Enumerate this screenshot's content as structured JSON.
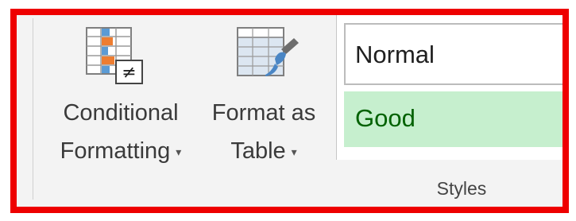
{
  "ribbon": {
    "conditional_formatting": {
      "line1": "Conditional",
      "line2": "Formatting",
      "caret": "▾"
    },
    "format_as_table": {
      "line1": "Format as",
      "line2": "Table",
      "caret": "▾"
    },
    "styles_gallery": {
      "items": [
        {
          "label": "Normal",
          "fill": "#ffffff",
          "text_color": "#1f1f1f"
        },
        {
          "label": "Good",
          "fill": "#c6efce",
          "text_color": "#006100"
        }
      ]
    },
    "group_label": "Styles"
  },
  "colors": {
    "highlight_border": "#ee0000",
    "ribbon_bg": "#f3f3f3"
  },
  "icons": {
    "conditional_formatting": "conditional-formatting-icon",
    "format_as_table": "format-as-table-icon"
  }
}
